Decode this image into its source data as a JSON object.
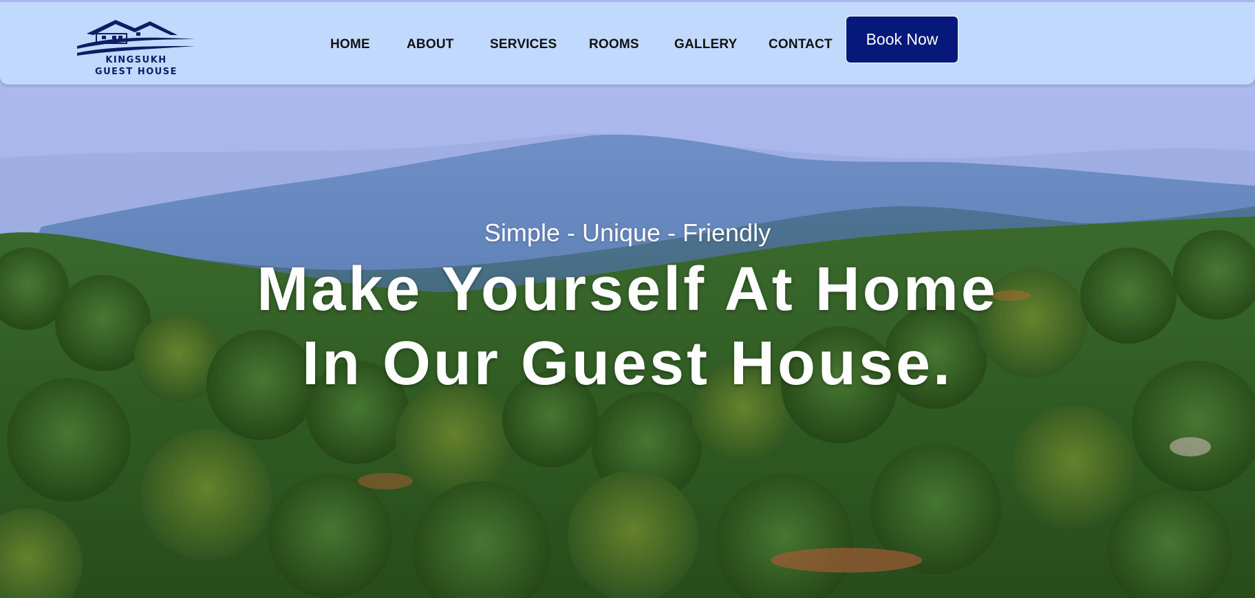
{
  "brand": {
    "name_line1": "KINGSUKH",
    "name_line2": "GUEST HOUSE"
  },
  "nav": {
    "items": [
      {
        "label": "HOME"
      },
      {
        "label": "ABOUT"
      },
      {
        "label": "SERVICES"
      },
      {
        "label": "ROOMS"
      },
      {
        "label": "GALLERY"
      },
      {
        "label": "CONTACT"
      }
    ],
    "book_label": "Book Now"
  },
  "hero": {
    "tagline": "Simple - Unique - Friendly",
    "headline_line1": "Make Yourself At Home",
    "headline_line2": "In Our Guest House."
  },
  "colors": {
    "navbar_bg": "#c1d9fd",
    "brand_navy": "#06197a",
    "nav_text": "#111111",
    "hero_text": "#ffffff"
  }
}
